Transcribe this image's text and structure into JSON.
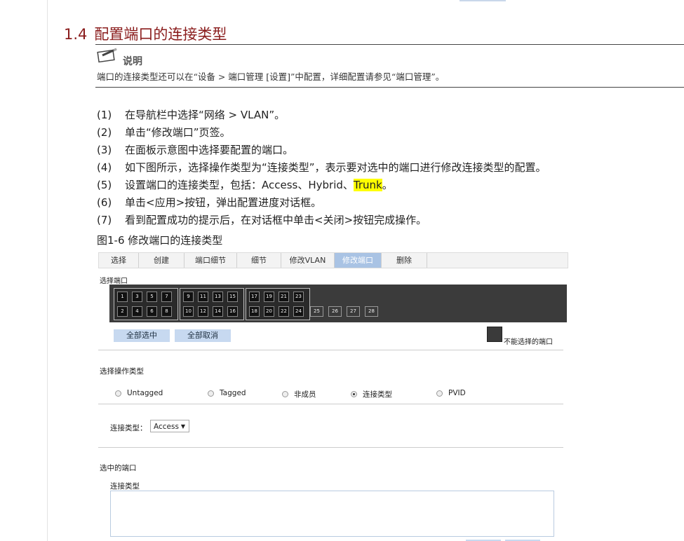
{
  "section": {
    "number": "1.4",
    "title": "配置端口的连接类型"
  },
  "note": {
    "icon": "note-pencil-icon",
    "title": "说明",
    "text": "端口的连接类型还可以在“设备 > 端口管理 [设置]”中配置，详细配置请参见“端口管理”。"
  },
  "steps": [
    {
      "num": "(1)",
      "text": "在导航栏中选择“网络 > VLAN”。"
    },
    {
      "num": "(2)",
      "text": "单击“修改端口”页签。"
    },
    {
      "num": "(3)",
      "text": "在面板示意图中选择要配置的端口。"
    },
    {
      "num": "(4)",
      "text": "如下图所示，选择操作类型为“连接类型”，表示要对选中的端口进行修改连接类型的配置。"
    },
    {
      "num": "(5)",
      "text": "设置端口的连接类型，包括：Access、Hybrid、",
      "highlight": "Trunk",
      "after": "。"
    },
    {
      "num": "(6)",
      "text": "单击<应用>按钮，弹出配置进度对话框。"
    },
    {
      "num": "(7)",
      "text": "看到配置成功的提示后，在对话框中单击<关闭>按钮完成操作。"
    }
  ],
  "figure": {
    "caption": "图1-6 修改端口的连接类型"
  },
  "screenshot": {
    "tabs": [
      "选择",
      "创建",
      "端口细节",
      "细节",
      "修改VLAN",
      "修改端口",
      "删除"
    ],
    "active_tab": "修改端口",
    "select_port_label": "选择端口",
    "port_numbers_top": [
      "1",
      "3",
      "5",
      "7",
      "9",
      "11",
      "13",
      "15",
      "17",
      "19",
      "21",
      "23"
    ],
    "port_numbers_bottom": [
      "2",
      "4",
      "6",
      "8",
      "10",
      "12",
      "14",
      "16",
      "18",
      "20",
      "22",
      "24"
    ],
    "disabled_ports": [
      "25",
      "26",
      "27",
      "28"
    ],
    "select_all_button": "全部选中",
    "deselect_all_button": "全部取消",
    "legend_label": "不能选择的端口",
    "operation_type_title": "选择操作类型",
    "operation_options": [
      "Untagged",
      "Tagged",
      "非成员",
      "连接类型",
      "PVID"
    ],
    "selected_operation": "连接类型",
    "link_type_label": "连接类型：",
    "link_type_value": "Access",
    "selected_ports_label": "选中的端口",
    "selected_link_type_label": "连接类型"
  }
}
